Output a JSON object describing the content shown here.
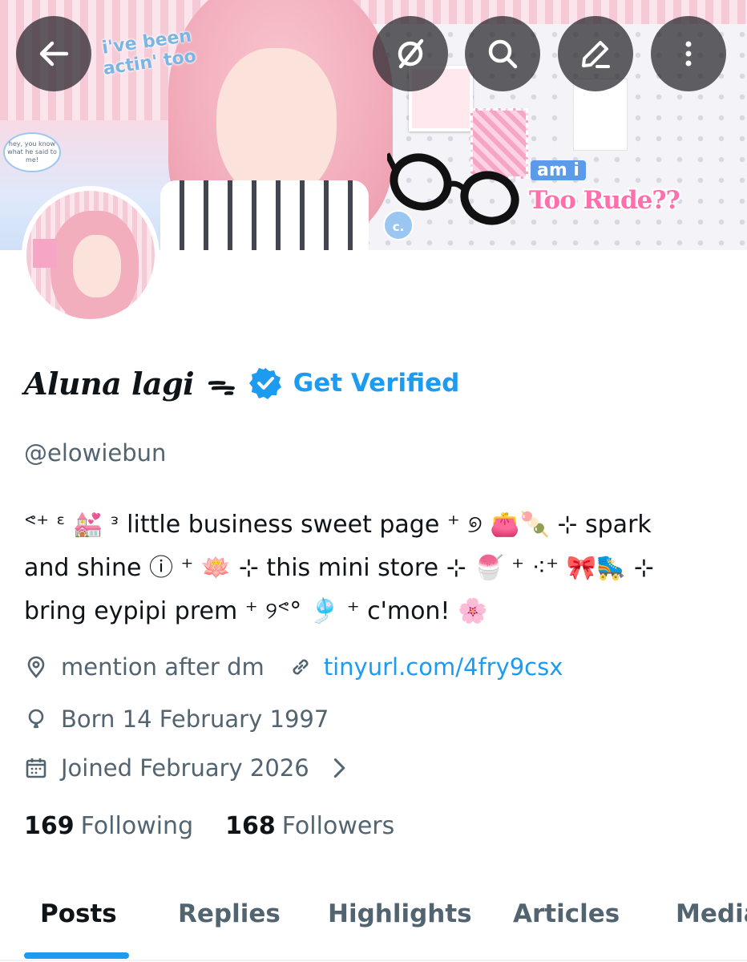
{
  "banner": {
    "sticker_text": "i've been actin' too",
    "bubble_text": "hey, you know what he said to me!",
    "am_i_text": "am i",
    "too_rude_text": "Too Rude??",
    "badge_letter": "c."
  },
  "profile": {
    "display_name": "Aluna lagi ᯓ",
    "get_verified_label": "Get Verified",
    "handle": "@elowiebun",
    "bio_lines": [
      "ᕝ⁺ ᵋ 💒 ᵌ little business sweet page ⁺ ୭ 👛🍡 ⊹ spark",
      "and shine ⓘ ⁺ 🪷 ⊹ this mini store ⊹ 🍧 ⁺ ⁖⁺ 🎀🛼 ⊹",
      "bring eypipi prem ⁺ ୨ᕝ° 🎐 ⁺ c'mon! 🌸"
    ],
    "location": "mention after dm",
    "link": "tinyurl.com/4fry9csx",
    "born": "Born 14 February 1997",
    "joined": "Joined February 2026",
    "following_count": "169",
    "following_label": "Following",
    "followers_count": "168",
    "followers_label": "Followers"
  },
  "tabs": {
    "posts": "Posts",
    "replies": "Replies",
    "highlights": "Highlights",
    "articles": "Articles",
    "media": "Media"
  },
  "colors": {
    "accent": "#1d9bf0",
    "secondary_text": "#536471",
    "primary_text": "#0f1419"
  },
  "icons": [
    "back-arrow-icon",
    "grok-icon",
    "search-icon",
    "edit-icon",
    "more-icon",
    "verified-badge-icon",
    "location-icon",
    "link-icon",
    "birthday-icon",
    "calendar-icon",
    "chevron-right-icon"
  ]
}
